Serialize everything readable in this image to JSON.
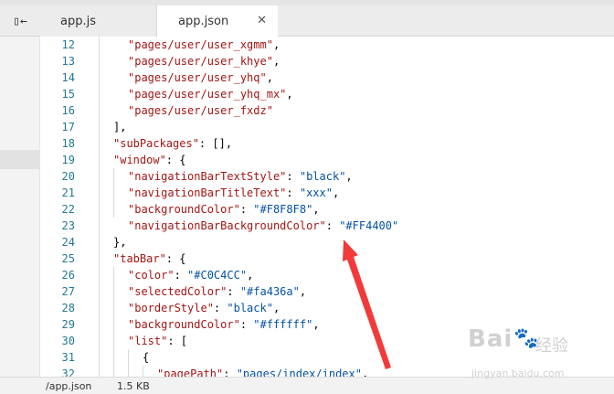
{
  "tabs": [
    {
      "label": "app.js"
    },
    {
      "label": "app.json",
      "close": "✕"
    }
  ],
  "sidebar_toggle": "▯←",
  "editor": {
    "lines": [
      {
        "num": "12",
        "tokens": [
          {
            "t": "\"pages/user/user_xgmm\"",
            "c": "k"
          },
          {
            "t": ",",
            "c": ""
          }
        ]
      },
      {
        "num": "13",
        "tokens": [
          {
            "t": "\"pages/user/user_khye\"",
            "c": "k"
          },
          {
            "t": ",",
            "c": ""
          }
        ]
      },
      {
        "num": "14",
        "tokens": [
          {
            "t": "\"pages/user/user_yhq\"",
            "c": "k"
          },
          {
            "t": ",",
            "c": ""
          }
        ]
      },
      {
        "num": "15",
        "tokens": [
          {
            "t": "\"pages/user/user_yhq_mx\"",
            "c": "k"
          },
          {
            "t": ",",
            "c": ""
          }
        ]
      },
      {
        "num": "16",
        "tokens": [
          {
            "t": "\"pages/user/user_fxdz\"",
            "c": "k"
          }
        ]
      },
      {
        "num": "17",
        "tokens": [
          {
            "t": "],",
            "c": ""
          }
        ]
      },
      {
        "num": "18",
        "tokens": [
          {
            "t": "\"subPackages\"",
            "c": "k"
          },
          {
            "t": ": [],",
            "c": ""
          }
        ]
      },
      {
        "num": "19",
        "tokens": [
          {
            "t": "\"window\"",
            "c": "k"
          },
          {
            "t": ": {",
            "c": ""
          }
        ]
      },
      {
        "num": "20",
        "tokens": [
          {
            "t": "\"navigationBarTextStyle\"",
            "c": "k"
          },
          {
            "t": ": ",
            "c": ""
          },
          {
            "t": "\"black\"",
            "c": "v"
          },
          {
            "t": ",",
            "c": ""
          }
        ]
      },
      {
        "num": "21",
        "tokens": [
          {
            "t": "\"navigationBarTitleText\"",
            "c": "k"
          },
          {
            "t": ": ",
            "c": ""
          },
          {
            "t": "\"xxx\"",
            "c": "v"
          },
          {
            "t": ",",
            "c": ""
          }
        ]
      },
      {
        "num": "22",
        "tokens": [
          {
            "t": "\"backgroundColor\"",
            "c": "k"
          },
          {
            "t": ": ",
            "c": ""
          },
          {
            "t": "\"#F8F8F8\"",
            "c": "v"
          },
          {
            "t": ",",
            "c": ""
          }
        ]
      },
      {
        "num": "23",
        "tokens": [
          {
            "t": "\"navigationBarBackgroundColor\"",
            "c": "k"
          },
          {
            "t": ": ",
            "c": ""
          },
          {
            "t": "\"#FF4400\"",
            "c": "v"
          }
        ]
      },
      {
        "num": "24",
        "tokens": [
          {
            "t": "},",
            "c": ""
          }
        ]
      },
      {
        "num": "25",
        "tokens": [
          {
            "t": "\"tabBar\"",
            "c": "k"
          },
          {
            "t": ": {",
            "c": ""
          }
        ]
      },
      {
        "num": "26",
        "tokens": [
          {
            "t": "\"color\"",
            "c": "k"
          },
          {
            "t": ": ",
            "c": ""
          },
          {
            "t": "\"#C0C4CC\"",
            "c": "v"
          },
          {
            "t": ",",
            "c": ""
          }
        ]
      },
      {
        "num": "27",
        "tokens": [
          {
            "t": "\"selectedColor\"",
            "c": "k"
          },
          {
            "t": ": ",
            "c": ""
          },
          {
            "t": "\"#fa436a\"",
            "c": "v"
          },
          {
            "t": ",",
            "c": ""
          }
        ]
      },
      {
        "num": "28",
        "tokens": [
          {
            "t": "\"borderStyle\"",
            "c": "k"
          },
          {
            "t": ": ",
            "c": ""
          },
          {
            "t": "\"black\"",
            "c": "v"
          },
          {
            "t": ",",
            "c": ""
          }
        ]
      },
      {
        "num": "29",
        "tokens": [
          {
            "t": "\"backgroundColor\"",
            "c": "k"
          },
          {
            "t": ": ",
            "c": ""
          },
          {
            "t": "\"#ffffff\"",
            "c": "v"
          },
          {
            "t": ",",
            "c": ""
          }
        ]
      },
      {
        "num": "30",
        "tokens": [
          {
            "t": "\"list\"",
            "c": "k"
          },
          {
            "t": ": [",
            "c": ""
          }
        ]
      },
      {
        "num": "31",
        "tokens": [
          {
            "t": "{",
            "c": ""
          }
        ]
      },
      {
        "num": "32",
        "tokens": [
          {
            "t": "\"pagePath\"",
            "c": "k"
          },
          {
            "t": ": ",
            "c": ""
          },
          {
            "t": "\"pages/index/index\"",
            "c": "v"
          },
          {
            "t": ",",
            "c": ""
          }
        ]
      }
    ]
  },
  "status": {
    "file": "/app.json",
    "size": "1.5 KB"
  },
  "colors": {
    "annotation_arrow": "#f23a3a",
    "key": "#a31515",
    "value": "#0451a5",
    "line_number": "#237893"
  },
  "watermark": {
    "brand": "Bai",
    "brand2": "经验",
    "url": "jingyan.baidu.com",
    "icon": "paw-icon"
  }
}
